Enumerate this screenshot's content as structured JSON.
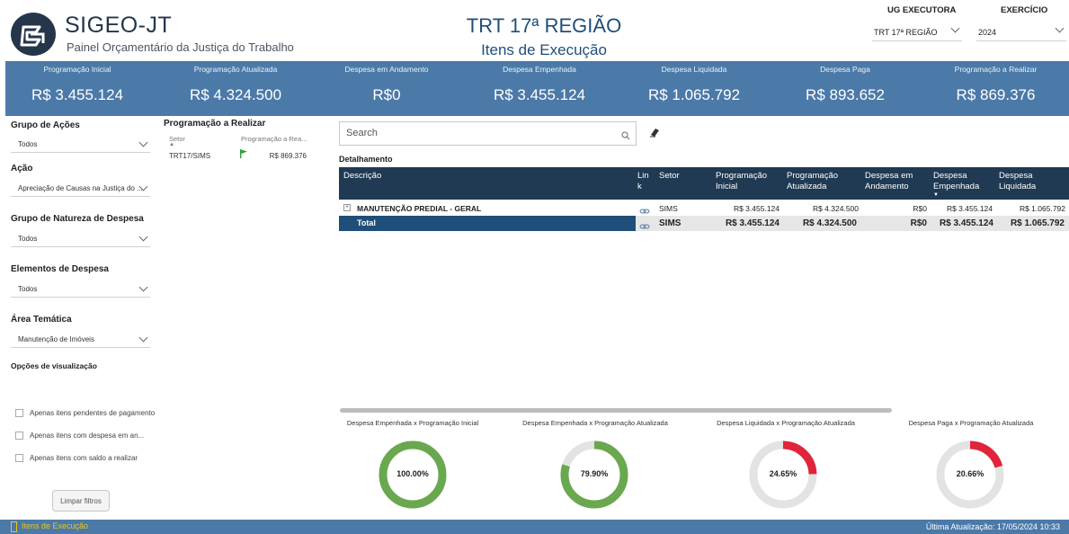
{
  "header": {
    "app_title": "SIGEO-JT",
    "app_subtitle": "Painel Orçamentário da Justiça do Trabalho",
    "region_title": "TRT 17ª REGIÃO",
    "page_subtitle": "Itens de Execução",
    "ug_label": "UG EXECUTORA",
    "ug_value": "TRT 17ª REGIÃO",
    "exercicio_label": "EXERCÍCIO",
    "exercicio_value": "2024"
  },
  "kpis": [
    {
      "label": "Programação Inicial",
      "value": "R$ 3.455.124"
    },
    {
      "label": "Programação Atualizada",
      "value": "R$ 4.324.500"
    },
    {
      "label": "Despesa em Andamento",
      "value": "R$0"
    },
    {
      "label": "Despesa Empenhada",
      "value": "R$ 3.455.124"
    },
    {
      "label": "Despesa Liquidada",
      "value": "R$ 1.065.792"
    },
    {
      "label": "Despesa Paga",
      "value": "R$ 893.652"
    },
    {
      "label": "Programação a Realizar",
      "value": "R$ 869.376"
    }
  ],
  "filters": {
    "grupo_acoes": {
      "label": "Grupo de Ações",
      "value": "Todos"
    },
    "acao": {
      "label": "Ação",
      "value": "Apreciação de Causas na Justiça do ..."
    },
    "grupo_natureza": {
      "label": "Grupo de Natureza de Despesa",
      "value": "Todos"
    },
    "elementos": {
      "label": "Elementos de Despesa",
      "value": "Todos"
    },
    "area_tematica": {
      "label": "Área Temática",
      "value": "Manutenção de Imóveis"
    },
    "opcoes_label": "Opções de visualização",
    "options": [
      "Apenas itens pendentes de pagamento",
      "Apenas itens com despesa em an...",
      "Apenas itens com saldo a realizar"
    ],
    "clear_label": "Limpar filtros"
  },
  "prog_table": {
    "title": "Programação a Realizar",
    "col_setor": "Setor",
    "col_prog": "Programação a Rea...",
    "rows": [
      {
        "setor": "TRT17/SIMS",
        "valor": "R$ 869.376"
      }
    ]
  },
  "search": {
    "placeholder": "Search"
  },
  "detail": {
    "title": "Detalhamento",
    "columns": {
      "descricao": "Descrição",
      "link1": "Lin",
      "link2": "k",
      "setor": "Setor",
      "prog_ini1": "Programação",
      "prog_ini2": "Inicial",
      "prog_atu1": "Programação",
      "prog_atu2": "Atualizada",
      "andamento1": "Despesa em",
      "andamento2": "Andamento",
      "empenhada1": "Despesa",
      "empenhada2": "Empenhada",
      "liquidada1": "Despesa",
      "liquidada2": "Liquidada"
    },
    "row": {
      "descricao": "MANUTENÇÃO PREDIAL - GERAL",
      "setor": "SIMS",
      "prog_ini": "R$ 3.455.124",
      "prog_atu": "R$ 4.324.500",
      "andamento": "R$0",
      "empenhada": "R$ 3.455.124",
      "liquidada": "R$ 1.065.792"
    },
    "total": {
      "label": "Total",
      "setor": "SIMS",
      "prog_ini": "R$ 3.455.124",
      "prog_atu": "R$ 4.324.500",
      "andamento": "R$0",
      "empenhada": "R$ 3.455.124",
      "liquidada": "R$ 1.065.792"
    }
  },
  "gauges": [
    {
      "title": "Despesa Empenhada x Programação Inicial",
      "label": "100.00%",
      "value": 100.0,
      "color": "#6aa84f"
    },
    {
      "title": "Despesa Empenhada x Programação Atualizada",
      "label": "79.90%",
      "value": 79.9,
      "color": "#6aa84f"
    },
    {
      "title": "Despesa Liquidada x Programação Atualizada",
      "label": "24.65%",
      "value": 24.65,
      "color": "#e0243a"
    },
    {
      "title": "Despesa Paga x Programação Atualizada",
      "label": "20.66%",
      "value": 20.66,
      "color": "#e0243a"
    }
  ],
  "footer": {
    "tab_label": "Itens de Execução",
    "updated": "Última Atualização: 17/05/2024 10:33"
  },
  "colors": {
    "kpi_band": "#4b7aa8",
    "table_header": "#1f3a52",
    "title_blue": "#1f4e79",
    "gauge_track": "#e3e3e3"
  }
}
